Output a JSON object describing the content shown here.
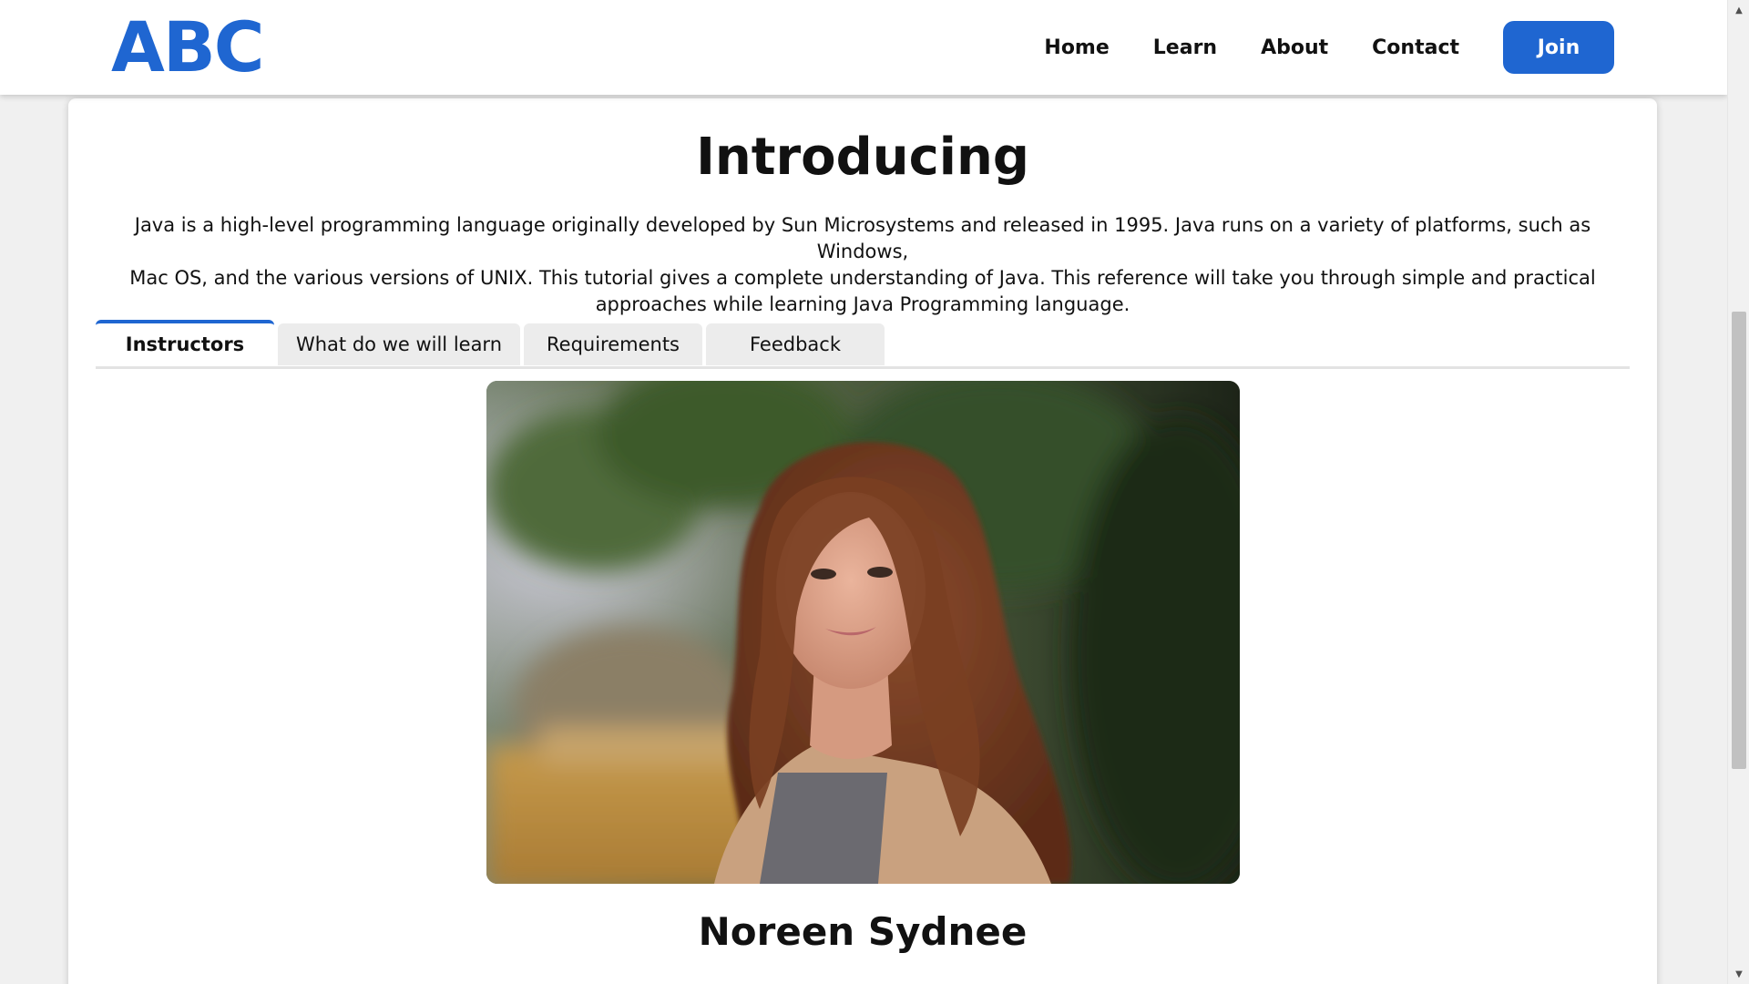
{
  "header": {
    "logo": "ABC",
    "nav": [
      "Home",
      "Learn",
      "About",
      "Contact"
    ],
    "join_label": "Join"
  },
  "main": {
    "title": "Introducing",
    "intro_lines": [
      "Java is a high-level programming language originally developed by Sun Microsystems and released in 1995. Java runs on a variety of platforms, such as Windows,",
      "Mac OS, and the various versions of UNIX. This tutorial gives a complete understanding of Java. This reference will take you through simple and practical",
      "approaches while learning Java Programming language."
    ],
    "tabs": [
      "Instructors",
      "What do we will learn",
      "Requirements",
      "Feedback"
    ],
    "active_tab": "Instructors",
    "instructor": {
      "name": "Noreen Sydnee"
    }
  },
  "colors": {
    "brand": "#1f66d1",
    "tab_inactive": "#ececec",
    "page_bg": "#f0f0f0"
  },
  "icons": {
    "scroll_up": "scroll-up-arrow-icon",
    "scroll_down": "scroll-down-arrow-icon"
  }
}
